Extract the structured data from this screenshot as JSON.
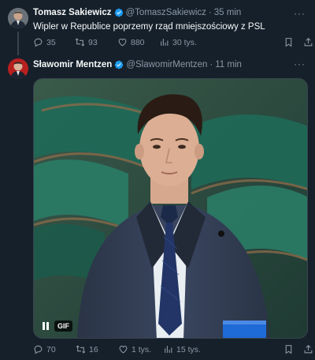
{
  "tweets": [
    {
      "author_name": "Tomasz Sakiewicz",
      "handle": "@TomaszSakiewicz",
      "separator": "·",
      "time": "35 min",
      "text": "Wipler w Republice poprzemy rząd mniejszościowy z PSL",
      "replies": "35",
      "retweets": "93",
      "likes": "880",
      "views": "30 tys."
    },
    {
      "author_name": "Sławomir Mentzen",
      "handle": "@SlawomirMentzen",
      "separator": "·",
      "time": "11 min",
      "media_badge": "GIF",
      "replies": "70",
      "retweets": "16",
      "likes": "1 tys.",
      "views": "15 tys."
    }
  ],
  "colors": {
    "background": "#15202b",
    "verified": "#1d9bf0",
    "muted": "#8b98a5"
  }
}
